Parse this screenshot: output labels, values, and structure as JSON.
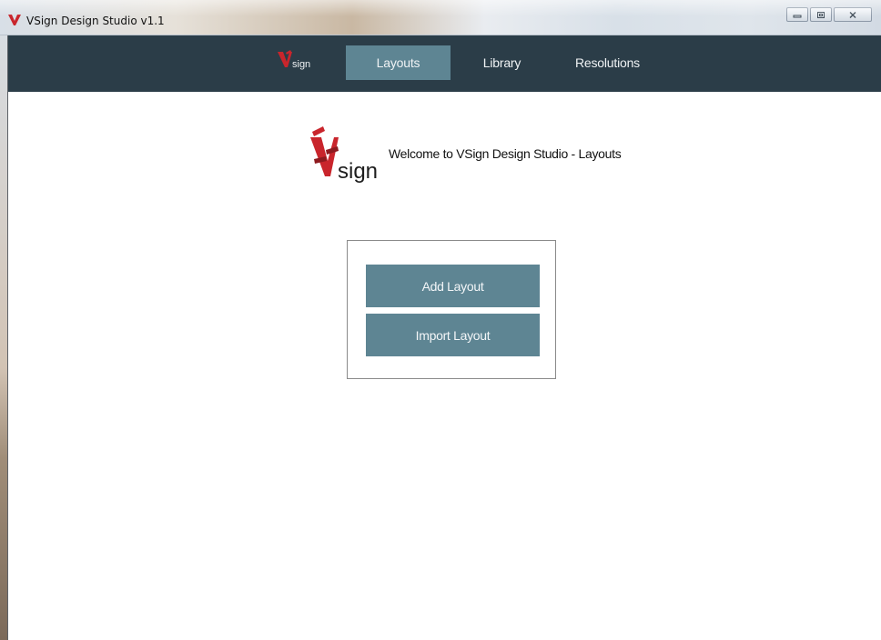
{
  "window": {
    "title": "VSign Design Studio v1.1",
    "controls": [
      "minimize",
      "maximize",
      "close"
    ]
  },
  "nav": {
    "logo_text": "sign",
    "tabs": [
      {
        "label": "Layouts",
        "active": true
      },
      {
        "label": "Library",
        "active": false
      },
      {
        "label": "Resolutions",
        "active": false
      }
    ]
  },
  "main": {
    "logo_text": "sign",
    "welcome": "Welcome to VSign Design Studio - Layouts",
    "buttons": {
      "add_layout": "Add Layout",
      "import_layout": "Import Layout"
    }
  },
  "colors": {
    "nav_bg": "#2b3d48",
    "accent": "#5e8593",
    "brand_red": "#c9252c"
  }
}
